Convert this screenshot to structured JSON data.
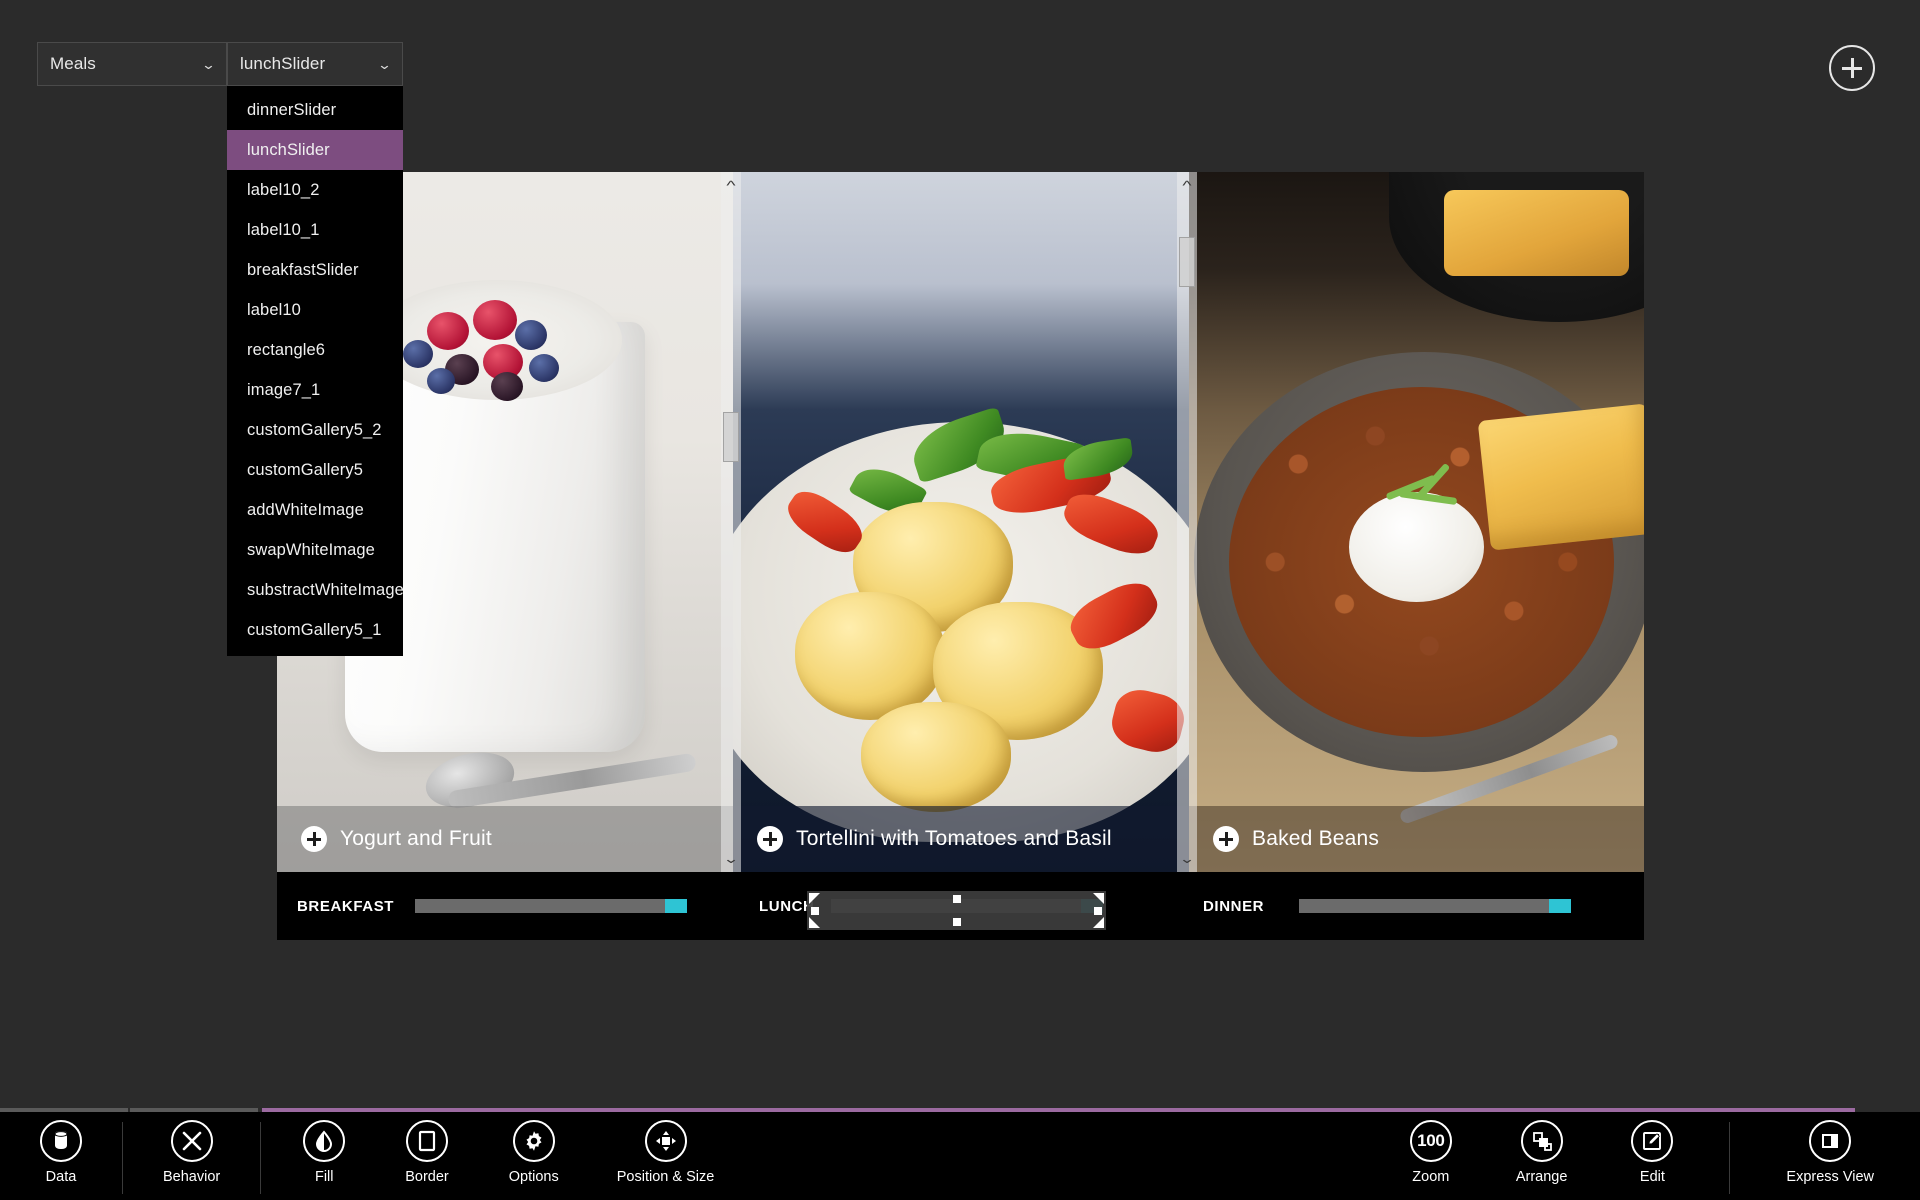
{
  "topbar": {
    "table_select": {
      "label": "Meals",
      "icon": "chevron-down-icon"
    },
    "object_select": {
      "label": "lunchSlider",
      "icon": "chevron-down-icon"
    },
    "add_button": {
      "icon": "plus-circle-icon"
    }
  },
  "object_dropdown": {
    "selected": "lunchSlider",
    "items": [
      "dinnerSlider",
      "lunchSlider",
      "label10_2",
      "label10_1",
      "breakfastSlider",
      "label10",
      "rectangle6",
      "image7_1",
      "customGallery5_2",
      "customGallery5",
      "addWhiteImage",
      "swapWhiteImage",
      "substractWhiteImage",
      "customGallery5_1"
    ]
  },
  "gallery": {
    "panels": [
      {
        "caption": "Yogurt and Fruit",
        "add_icon": "plus-circle-icon"
      },
      {
        "caption": "Tortellini with Tomatoes and Basil",
        "add_icon": "plus-circle-icon"
      },
      {
        "caption": "Baked Beans",
        "add_icon": "plus-circle-icon"
      }
    ],
    "scrollbars": [
      {
        "up_icon": "chevron-up-icon",
        "down_icon": "chevron-down-icon"
      },
      {
        "up_icon": "chevron-up-icon",
        "down_icon": "chevron-down-icon"
      }
    ]
  },
  "sliders": [
    {
      "label": "BREAKFAST",
      "value": 92,
      "track_color": "#6b6b6b",
      "fill_color": "#2ec4d4",
      "selected": false
    },
    {
      "label": "LUNCH",
      "value": 92,
      "track_color": "#6b6b6b",
      "fill_color": "#2ec4d4",
      "selected": true
    },
    {
      "label": "DINNER",
      "value": 92,
      "track_color": "#6b6b6b",
      "fill_color": "#2ec4d4",
      "selected": false
    }
  ],
  "toolbar": {
    "left_tools": [
      {
        "label": "Data",
        "icon": "database-icon"
      },
      {
        "label": "Behavior",
        "icon": "behavior-icon"
      },
      {
        "label": "Fill",
        "icon": "paint-bucket-icon"
      },
      {
        "label": "Border",
        "icon": "border-icon"
      },
      {
        "label": "Options",
        "icon": "gear-icon"
      },
      {
        "label": "Position & Size",
        "icon": "position-size-icon"
      }
    ],
    "right_tools": [
      {
        "label": "Zoom",
        "icon": "zoom-level-icon",
        "value": "100"
      },
      {
        "label": "Arrange",
        "icon": "arrange-icon"
      },
      {
        "label": "Edit",
        "icon": "edit-pencil-icon"
      },
      {
        "label": "Express View",
        "icon": "express-view-icon"
      }
    ],
    "active_tab_color": "#9b6aa0"
  }
}
